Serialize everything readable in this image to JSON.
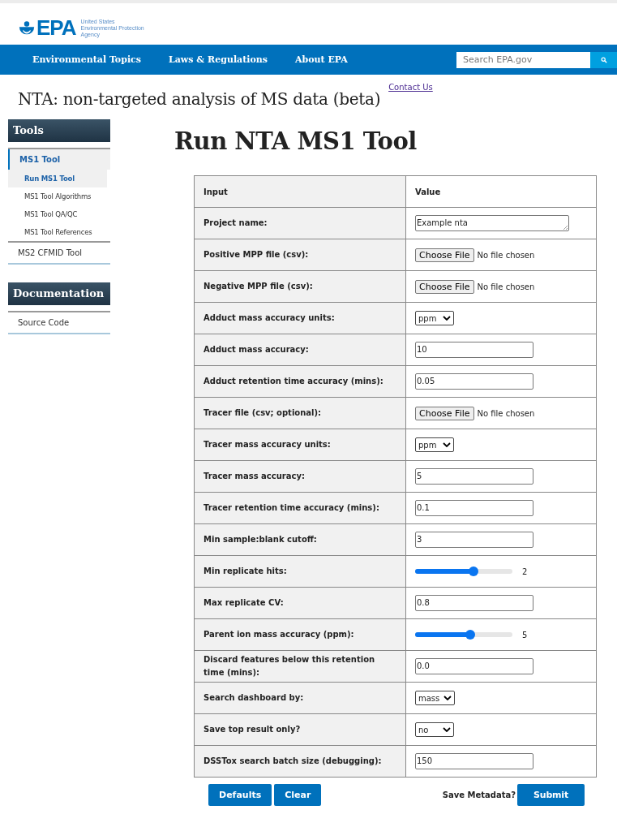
{
  "header": {
    "logo_text": "EPA",
    "agency_lines": [
      "United States",
      "Environmental Protection",
      "Agency"
    ]
  },
  "nav": {
    "items": [
      "Environmental Topics",
      "Laws & Regulations",
      "About EPA"
    ],
    "search": {
      "placeholder": "Search EPA.gov"
    }
  },
  "contact_link": "Contact Us",
  "site_title": "NTA: non-targeted analysis of MS data (beta)",
  "sidebar": [
    {
      "heading": "Tools",
      "items": [
        {
          "label": "MS1 Tool",
          "selected": true,
          "children": [
            {
              "label": "Run MS1 Tool",
              "selected": true
            },
            {
              "label": "MS1 Tool Algorithms",
              "selected": false
            },
            {
              "label": "MS1 Tool QA/QC",
              "selected": false
            },
            {
              "label": "MS1 Tool References",
              "selected": false
            }
          ]
        },
        {
          "label": "MS2 CFMID Tool",
          "selected": false
        }
      ]
    },
    {
      "heading": "Documentation",
      "items": [
        {
          "label": "Source Code",
          "selected": false
        }
      ]
    }
  ],
  "page_heading": "Run NTA MS1 Tool",
  "table": {
    "columns": [
      "Input",
      "Value"
    ],
    "rows": [
      {
        "label": "Project name:",
        "kind": "textarea",
        "value": "Example nta"
      },
      {
        "label": "Positive MPP file (csv):",
        "kind": "file",
        "button": "Choose File",
        "value": "No file chosen"
      },
      {
        "label": "Negative MPP file (csv):",
        "kind": "file",
        "button": "Choose File",
        "value": "No file chosen"
      },
      {
        "label": "Adduct mass accuracy units:",
        "kind": "select",
        "value": "ppm"
      },
      {
        "label": "Adduct mass accuracy:",
        "kind": "input",
        "value": "10"
      },
      {
        "label": "Adduct retention time accuracy (mins):",
        "kind": "input",
        "value": "0.05"
      },
      {
        "label": "Tracer file (csv; optional):",
        "kind": "file",
        "button": "Choose File",
        "value": "No file chosen"
      },
      {
        "label": "Tracer mass accuracy units:",
        "kind": "select",
        "value": "ppm"
      },
      {
        "label": "Tracer mass accuracy:",
        "kind": "input",
        "value": "5"
      },
      {
        "label": "Tracer retention time accuracy (mins):",
        "kind": "input",
        "value": "0.1"
      },
      {
        "label": "Min sample:blank cutoff:",
        "kind": "input",
        "value": "3"
      },
      {
        "label": "Min replicate hits:",
        "kind": "slider",
        "level": 0.6,
        "value": "2"
      },
      {
        "label": "Max replicate CV:",
        "kind": "input",
        "value": "0.8"
      },
      {
        "label": "Parent ion mass accuracy (ppm):",
        "kind": "slider",
        "level": 0.57,
        "value": "5"
      },
      {
        "label": "Discard features below this retention time (mins):",
        "kind": "input",
        "value": "0.0"
      },
      {
        "label": "Search dashboard by:",
        "kind": "select",
        "value": "mass"
      },
      {
        "label": "Save top result only?",
        "kind": "select",
        "value": "no"
      },
      {
        "label": "DSSTox search batch size (debugging):",
        "kind": "input",
        "value": "150"
      }
    ]
  },
  "actions": {
    "buttons": [
      "Defaults",
      "Clear"
    ],
    "metadata_label": "Save Metadata?",
    "submit": "Submit"
  }
}
